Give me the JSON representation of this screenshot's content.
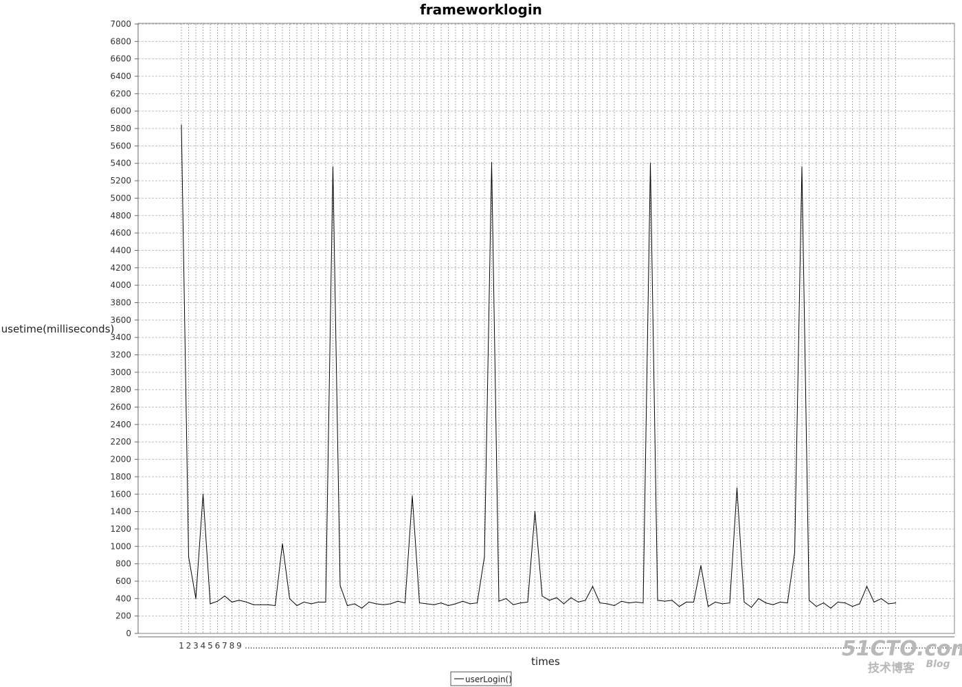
{
  "chart_data": {
    "type": "line",
    "title": "frameworklogin",
    "xlabel": "times",
    "ylabel": "usetime(milliseconds)",
    "ylim": [
      0,
      7000
    ],
    "y_ticks": [
      0,
      200,
      400,
      600,
      800,
      1000,
      1200,
      1400,
      1600,
      1800,
      2000,
      2200,
      2400,
      2600,
      2800,
      3000,
      3200,
      3400,
      3600,
      3800,
      4000,
      4200,
      4400,
      4600,
      4800,
      5000,
      5200,
      5400,
      5600,
      5800,
      6000,
      6200,
      6400,
      6600,
      6800,
      7000
    ],
    "x_tick_labels": [
      "1",
      "2",
      "3",
      "4",
      "5",
      "6",
      "7",
      "8",
      "9"
    ],
    "x_tick_ellipsis": "...................................................................................................................................................................................................................................................................................................",
    "grid": true,
    "legend": "bottom-center",
    "series": [
      {
        "name": "userLogin()",
        "color": "#000000",
        "values": [
          5840,
          880,
          400,
          1600,
          340,
          370,
          430,
          360,
          380,
          360,
          330,
          330,
          330,
          320,
          1030,
          400,
          320,
          360,
          340,
          360,
          360,
          5360,
          550,
          320,
          340,
          290,
          360,
          340,
          330,
          340,
          370,
          350,
          1580,
          350,
          340,
          330,
          350,
          320,
          340,
          370,
          340,
          350,
          880,
          5410,
          370,
          400,
          330,
          350,
          360,
          1400,
          430,
          380,
          410,
          340,
          410,
          360,
          380,
          540,
          350,
          340,
          320,
          370,
          350,
          360,
          350,
          5400,
          380,
          370,
          380,
          310,
          360,
          360,
          780,
          310,
          360,
          340,
          350,
          1670,
          360,
          300,
          400,
          350,
          330,
          360,
          350,
          930,
          5360,
          380,
          310,
          350,
          290,
          360,
          350,
          310,
          340,
          540,
          360,
          400,
          340,
          350
        ]
      }
    ]
  },
  "watermark": {
    "brand": "51CTO.com",
    "subtitle": "技术博客",
    "blog": "Blog"
  }
}
